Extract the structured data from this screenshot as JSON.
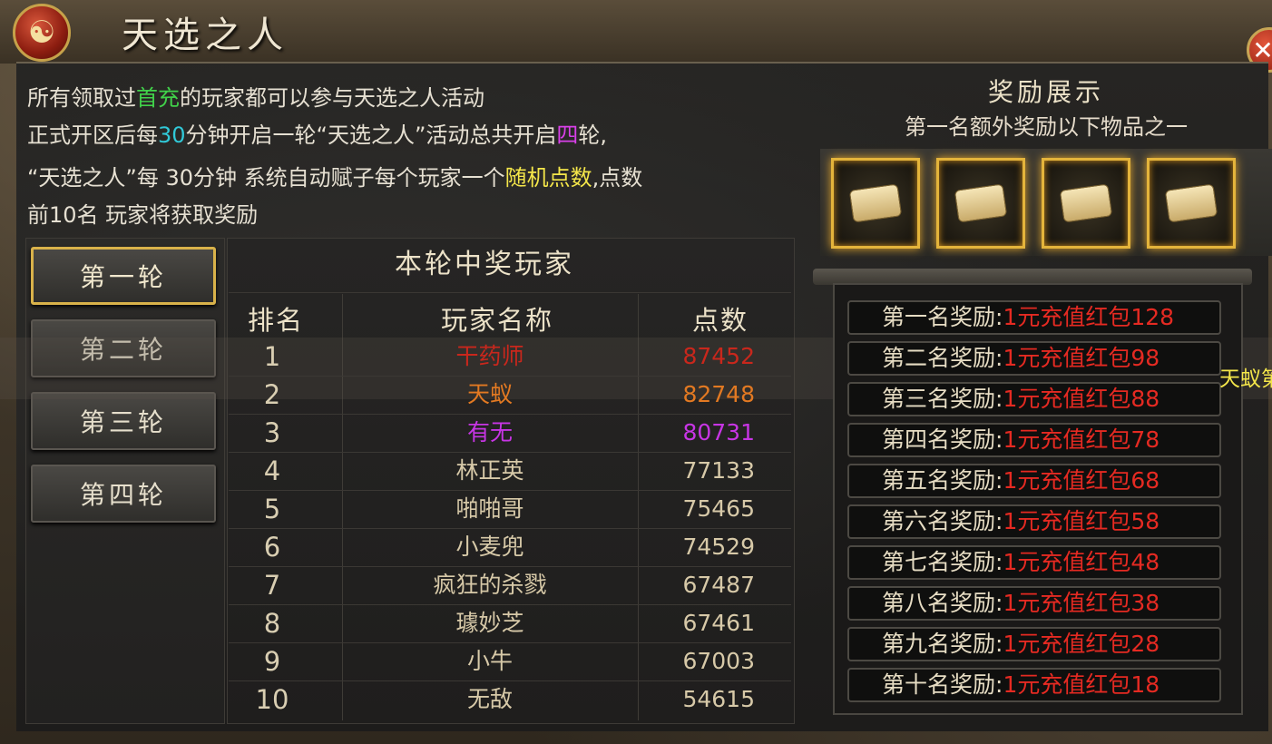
{
  "title": "天选之人",
  "emblem_icon": "yin-yang-icon",
  "close_icon": "close-icon",
  "description": {
    "line1": {
      "a": "所有领取过",
      "b": "首充",
      "c": "的玩家都可以参与天选之人活动"
    },
    "line2": {
      "a": "正式开区后每",
      "b": "30",
      "c": "分钟开启一轮“天选之人”活动总共开启",
      "d": "四",
      "e": "轮,"
    },
    "line3": {
      "a": "“天选之人”每 30分钟 系统自动赋子每个玩家一个",
      "b": "随机点数",
      "c": ",点数"
    },
    "line4": "前10名 玩家将获取奖励"
  },
  "rounds": [
    {
      "label": "第一轮",
      "active": true
    },
    {
      "label": "第二轮",
      "active": false
    },
    {
      "label": "第三轮",
      "active": false
    },
    {
      "label": "第四轮",
      "active": false
    }
  ],
  "table": {
    "title": "本轮中奖玩家",
    "headers": [
      "排名",
      "玩家名称",
      "点数"
    ],
    "rows": [
      {
        "rank": "1",
        "name": "干药师",
        "points": "87452"
      },
      {
        "rank": "2",
        "name": "天蚁",
        "points": "82748"
      },
      {
        "rank": "3",
        "name": "有无",
        "points": "80731"
      },
      {
        "rank": "4",
        "name": "林正英",
        "points": "77133"
      },
      {
        "rank": "5",
        "name": "啪啪哥",
        "points": "75465"
      },
      {
        "rank": "6",
        "name": "小麦兜",
        "points": "74529"
      },
      {
        "rank": "7",
        "name": "疯狂的杀戮",
        "points": "67487"
      },
      {
        "rank": "8",
        "name": "璩妙芝",
        "points": "67461"
      },
      {
        "rank": "9",
        "name": "小牛",
        "points": "67003"
      },
      {
        "rank": "10",
        "name": "无敌",
        "points": "54615"
      }
    ]
  },
  "rewards": {
    "title": "奖励展示",
    "subtitle": "第一名额外奖励以下物品之一",
    "items": [
      "scroll-icon",
      "scroll-icon",
      "scroll-icon",
      "scroll-icon"
    ],
    "list": [
      {
        "label": "第一名奖励:",
        "value": "1元充值红包128"
      },
      {
        "label": "第二名奖励:",
        "value": "1元充值红包98"
      },
      {
        "label": "第三名奖励:",
        "value": "1元充值红包88"
      },
      {
        "label": "第四名奖励:",
        "value": "1元充值红包78"
      },
      {
        "label": "第五名奖励:",
        "value": "1元充值红包68"
      },
      {
        "label": "第六名奖励:",
        "value": "1元充值红包58"
      },
      {
        "label": "第七名奖励:",
        "value": "1元充值红包48"
      },
      {
        "label": "第八名奖励:",
        "value": "1元充值红包38"
      },
      {
        "label": "第九名奖励:",
        "value": "1元充值红包28"
      },
      {
        "label": "第十名奖励:",
        "value": "1元充值红包18"
      }
    ]
  },
  "overflow_text": "天蚁第",
  "colors": {
    "rank1": "#c9271c",
    "rank2": "#e27922",
    "rank3": "#c735e4",
    "normal": "#d7c9a8",
    "reward_value": "#e52a22",
    "highlight_border": "#d9b24a"
  }
}
